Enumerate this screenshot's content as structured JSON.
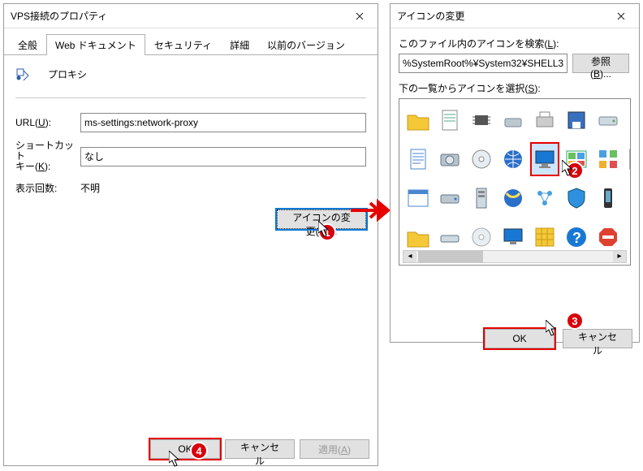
{
  "dlg1": {
    "title": "VPS接続のプロパティ",
    "tabs": [
      "全般",
      "Web ドキュメント",
      "セキュリティ",
      "詳細",
      "以前のバージョン"
    ],
    "active_tab": 1,
    "group_label": "プロキシ",
    "url_label": "URL(U):",
    "url_value": "ms-settings:network-proxy",
    "shortcut_label": "ショートカット\nキー(K):",
    "shortcut_value": "なし",
    "visits_label": "表示回数:",
    "visits_value": "不明",
    "change_icon_btn": "アイコンの変更(C)...",
    "ok": "OK",
    "cancel": "キャンセル",
    "apply": "適用(A)"
  },
  "dlg2": {
    "title": "アイコンの変更",
    "path_label": "このファイル内のアイコンを検索(L):",
    "path_value": "%SystemRoot%¥System32¥SHELL32.dll",
    "browse": "参照(B)...",
    "grid_label": "下の一覧からアイコンを選択(S):",
    "ok": "OK",
    "cancel": "キャンセル",
    "icons": [
      "folder",
      "page",
      "chip",
      "disk",
      "printer",
      "floppy",
      "drive",
      "drive2",
      "doc",
      "hdd",
      "cd",
      "globe",
      "monitor",
      "cpanel",
      "apps",
      "shortcut",
      "window",
      "hdd2",
      "server",
      "globe2",
      "network",
      "shield",
      "phone",
      "fonts",
      "folder2",
      "drive3",
      "disc",
      "screen",
      "grid",
      "help",
      "stop",
      "bin"
    ],
    "selected_index": 12
  },
  "callouts": {
    "c1": "1",
    "c2": "2",
    "c3": "3",
    "c4": "4"
  }
}
